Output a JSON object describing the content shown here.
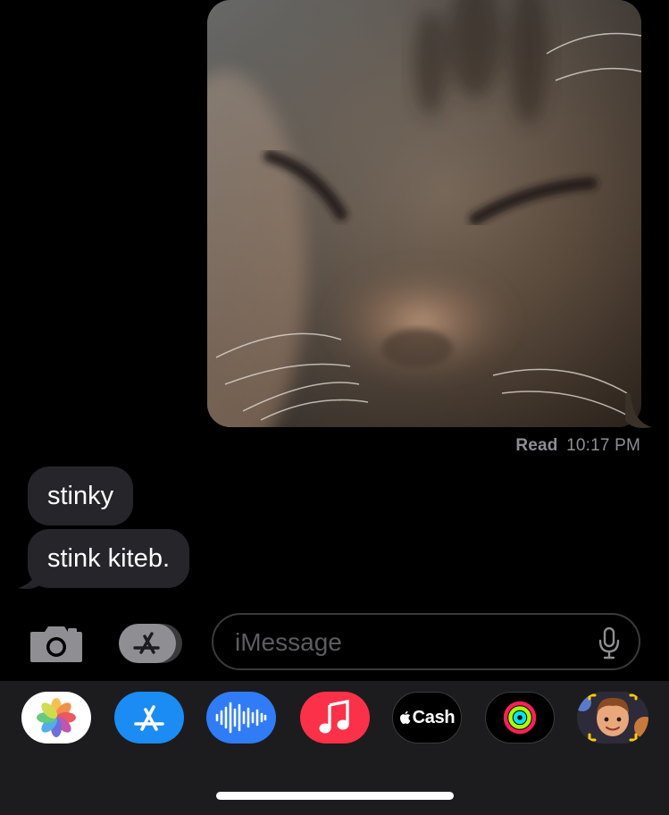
{
  "conversation": {
    "sent_photo": {
      "description_icon": "photo-attachment",
      "receipt": {
        "label": "Read",
        "time": "10:17 PM"
      }
    },
    "received_messages": [
      {
        "text": "stinky"
      },
      {
        "text": "stink kiteb."
      }
    ]
  },
  "composer": {
    "camera_icon": "camera-icon",
    "apps_icon": "app-store-icon",
    "placeholder": "iMessage",
    "mic_icon": "microphone-icon"
  },
  "app_drawer": {
    "apps": [
      {
        "name": "Photos",
        "icon": "photos-icon"
      },
      {
        "name": "App Store",
        "icon": "app-store-icon"
      },
      {
        "name": "Audio Message",
        "icon": "audio-waveform-icon"
      },
      {
        "name": "Music",
        "icon": "music-note-icon"
      },
      {
        "name": "Apple Cash",
        "icon": "apple-cash-icon",
        "label": "Cash"
      },
      {
        "name": "Activity",
        "icon": "activity-rings-icon"
      },
      {
        "name": "Memoji",
        "icon": "memoji-icon"
      }
    ]
  },
  "colors": {
    "background": "#000000",
    "received_bubble": "#26252a",
    "drawer": "#1c1c1e",
    "receipt_text": "#8e8e93",
    "placeholder_text": "#5c5c60"
  }
}
